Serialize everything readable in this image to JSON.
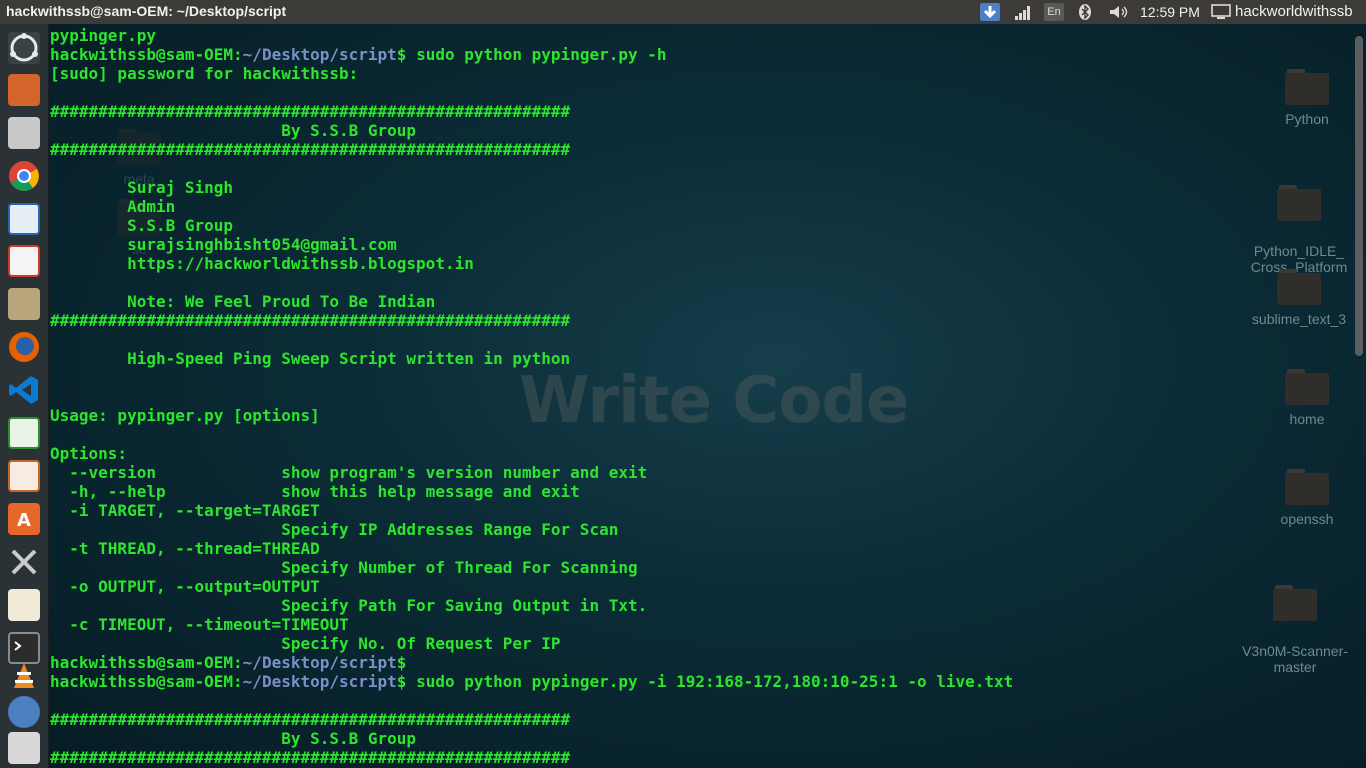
{
  "window": {
    "title": "hackwithssb@sam-OEM: ~/Desktop/script"
  },
  "topbar": {
    "time": "12:59 PM",
    "user": "hackworldwithssb",
    "keyboard": "En",
    "indicators": [
      "download-icon",
      "network-icon",
      "keyboard-icon",
      "bluetooth-icon",
      "volume-icon",
      "computer-icon"
    ]
  },
  "launcher": {
    "icons": [
      "ubuntu-dash-icon",
      "software-updater-icon",
      "files-cabinet-icon",
      "chrome-icon",
      "writer-icon",
      "pdf-viewer-icon",
      "home-folder-icon",
      "firefox-icon",
      "vscode-icon",
      "calc-icon",
      "impress-icon",
      "software-center-icon",
      "system-tools-icon",
      "text-editor-icon",
      "terminal-icon",
      "vlc-icon",
      "installer-icon",
      "trash-icon"
    ]
  },
  "desktop": {
    "watermark": "Write Code",
    "icons": [
      {
        "label": "Python"
      },
      {
        "label": "Python_IDLE_\nCross_Platform"
      },
      {
        "label": "sublime_text_3"
      },
      {
        "label": "home"
      },
      {
        "label": "openssh"
      },
      {
        "label": "V3n0M-Scanner-\nmaster"
      }
    ],
    "hidden_icons": [
      {
        "label": "meta"
      },
      {
        "label": "sc"
      }
    ]
  },
  "terminal": {
    "user": "hackwithssb@sam-OEM",
    "path": "~/Desktop/script",
    "lines": [
      {
        "t": "out",
        "text": "pypinger.py"
      },
      {
        "t": "prompt",
        "cmd": "sudo python pypinger.py -h"
      },
      {
        "t": "out",
        "text": "[sudo] password for hackwithssb:"
      },
      {
        "t": "out",
        "text": ""
      },
      {
        "t": "out",
        "text": "######################################################"
      },
      {
        "t": "out",
        "text": "                        By S.S.B Group"
      },
      {
        "t": "out",
        "text": "######################################################"
      },
      {
        "t": "out",
        "text": ""
      },
      {
        "t": "out",
        "text": "        Suraj Singh"
      },
      {
        "t": "out",
        "text": "        Admin"
      },
      {
        "t": "out",
        "text": "        S.S.B Group"
      },
      {
        "t": "out",
        "text": "        surajsinghbisht054@gmail.com"
      },
      {
        "t": "out",
        "text": "        https://hackworldwithssb.blogspot.in"
      },
      {
        "t": "out",
        "text": ""
      },
      {
        "t": "out",
        "text": "        Note: We Feel Proud To Be Indian"
      },
      {
        "t": "out",
        "text": "######################################################"
      },
      {
        "t": "out",
        "text": ""
      },
      {
        "t": "out",
        "text": "        High-Speed Ping Sweep Script written in python"
      },
      {
        "t": "out",
        "text": ""
      },
      {
        "t": "out",
        "text": ""
      },
      {
        "t": "out",
        "text": "Usage: pypinger.py [options]"
      },
      {
        "t": "out",
        "text": ""
      },
      {
        "t": "out",
        "text": "Options:"
      },
      {
        "t": "out",
        "text": "  --version             show program's version number and exit"
      },
      {
        "t": "out",
        "text": "  -h, --help            show this help message and exit"
      },
      {
        "t": "out",
        "text": "  -i TARGET, --target=TARGET"
      },
      {
        "t": "out",
        "text": "                        Specify IP Addresses Range For Scan"
      },
      {
        "t": "out",
        "text": "  -t THREAD, --thread=THREAD"
      },
      {
        "t": "out",
        "text": "                        Specify Number of Thread For Scanning"
      },
      {
        "t": "out",
        "text": "  -o OUTPUT, --output=OUTPUT"
      },
      {
        "t": "out",
        "text": "                        Specify Path For Saving Output in Txt."
      },
      {
        "t": "out",
        "text": "  -c TIMEOUT, --timeout=TIMEOUT"
      },
      {
        "t": "out",
        "text": "                        Specify No. Of Request Per IP"
      },
      {
        "t": "prompt",
        "cmd": ""
      },
      {
        "t": "prompt",
        "cmd": "sudo python pypinger.py -i 192:168-172,180:10-25:1 -o live.txt"
      },
      {
        "t": "out",
        "text": ""
      },
      {
        "t": "out",
        "text": "######################################################"
      },
      {
        "t": "out",
        "text": "                        By S.S.B Group"
      },
      {
        "t": "out",
        "text": "######################################################"
      }
    ]
  }
}
